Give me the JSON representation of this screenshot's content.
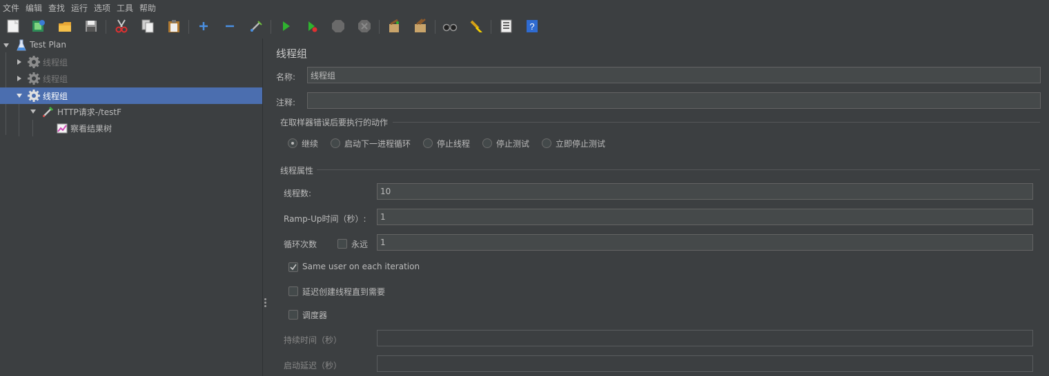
{
  "menu": [
    "文件",
    "编辑",
    "查找",
    "运行",
    "选项",
    "工具",
    "帮助"
  ],
  "toolbar": {
    "icons": [
      "new-icon",
      "templates-icon",
      "open-icon",
      "save-icon",
      "cut-icon",
      "copy-icon",
      "paste-icon",
      "expand-icon",
      "collapse-icon",
      "toggle-icon",
      "start-icon",
      "start-no-pauses-icon",
      "stop-icon",
      "shutdown-icon",
      "clear-icon",
      "clear-all-icon",
      "search-icon",
      "reset-search-icon",
      "function-helper-icon",
      "help-icon"
    ]
  },
  "tree": {
    "root": "Test Plan",
    "items": [
      {
        "label": "线程组",
        "disabled": true
      },
      {
        "label": "线程组",
        "disabled": true
      },
      {
        "label": "线程组",
        "selected": true
      },
      {
        "label": "HTTP请求-/testF"
      },
      {
        "label": "察看结果树"
      }
    ]
  },
  "panel": {
    "title": "线程组",
    "name_label": "名称:",
    "name_value": "线程组",
    "comment_label": "注释:",
    "comment_value": "",
    "error_section": "在取样器错误后要执行的动作",
    "error_options": [
      "继续",
      "启动下一进程循环",
      "停止线程",
      "停止测试",
      "立即停止测试"
    ],
    "error_selected": 0,
    "thread_section": "线程属性",
    "threads_label": "线程数:",
    "threads_value": "10",
    "rampup_label": "Ramp-Up时间（秒）:",
    "rampup_value": "1",
    "loop_label": "循环次数",
    "forever_label": "永远",
    "forever_checked": false,
    "loop_value": "1",
    "same_user_label": "Same user on each iteration",
    "same_user_checked": true,
    "delay_label": "延迟创建线程直到需要",
    "delay_checked": false,
    "scheduler_label": "调度器",
    "scheduler_checked": false,
    "duration_label": "持续时间（秒）",
    "duration_value": "",
    "startup_delay_label": "启动延迟（秒）",
    "startup_delay_value": ""
  },
  "colors": {
    "background": "#3c3f41",
    "selection": "#4b6eaf",
    "field": "#45494a",
    "text": "#bbbbbb"
  }
}
